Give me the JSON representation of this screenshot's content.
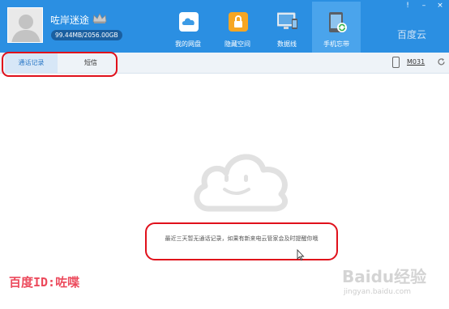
{
  "header": {
    "username": "咗岸迷途",
    "storage": "99.44MB/2056.00GB",
    "brand": "百度云"
  },
  "nav": [
    {
      "label": "我的网盘",
      "icon": "cloud-drive-icon"
    },
    {
      "label": "隐藏空间",
      "icon": "lock-icon"
    },
    {
      "label": "数据线",
      "icon": "monitor-icon"
    },
    {
      "label": "手机忘带",
      "icon": "phone-sync-icon",
      "active": true
    }
  ],
  "window_controls": {
    "notify": "!",
    "minimize": "–",
    "close": "×"
  },
  "tabs": [
    {
      "label": "通话记录",
      "active": true
    },
    {
      "label": "短信",
      "active": false
    }
  ],
  "device": {
    "name": "M031"
  },
  "empty_state": {
    "message": "最近三天暂无通话记录，如果有新来电云管家会及时提醒你哦"
  },
  "watermark": {
    "left": "百度ID:咗喋",
    "right_line1": "Baidu经验",
    "right_line2": "jingyan.baidu.com"
  },
  "colors": {
    "header": "#2b8fe2",
    "highlight": "#e0101b",
    "accent": "#2b78c6"
  }
}
